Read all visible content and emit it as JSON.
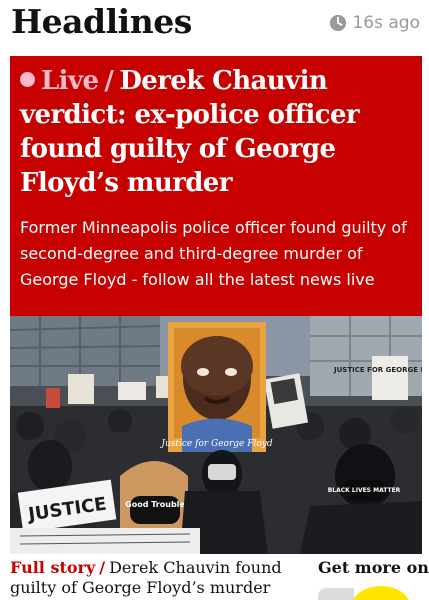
{
  "header": {
    "title": "Headlines",
    "timestamp": "16s ago",
    "clock_icon": "clock-icon"
  },
  "main_story": {
    "kicker": "Live",
    "separator": "/",
    "headline": "Derek Chauvin verdict: ex-police officer found guilty of George Floyd’s murder",
    "standfirst": "Former Minneapolis police officer found guilty of second-degree and third-degree murder of George Floyd - follow all the latest news live",
    "background_color": "#c70000",
    "kicker_color": "#ffbac8"
  },
  "photo": {
    "description_icon": "protest-photo",
    "sign_text_1": "JUSTICE",
    "sign_text_2": "Good Trouble",
    "sign_text_3": "Justice for George Floyd",
    "sign_text_4": "JUSTICE FOR GEORGE FLOYD",
    "sign_text_5": "BLACK LIVES MATTER"
  },
  "secondary_story": {
    "kicker": "Full story",
    "separator": "/",
    "headline": "Derek Chauvin found guilty of George Floyd’s murder"
  },
  "side_promo": {
    "label": "Get more on"
  }
}
